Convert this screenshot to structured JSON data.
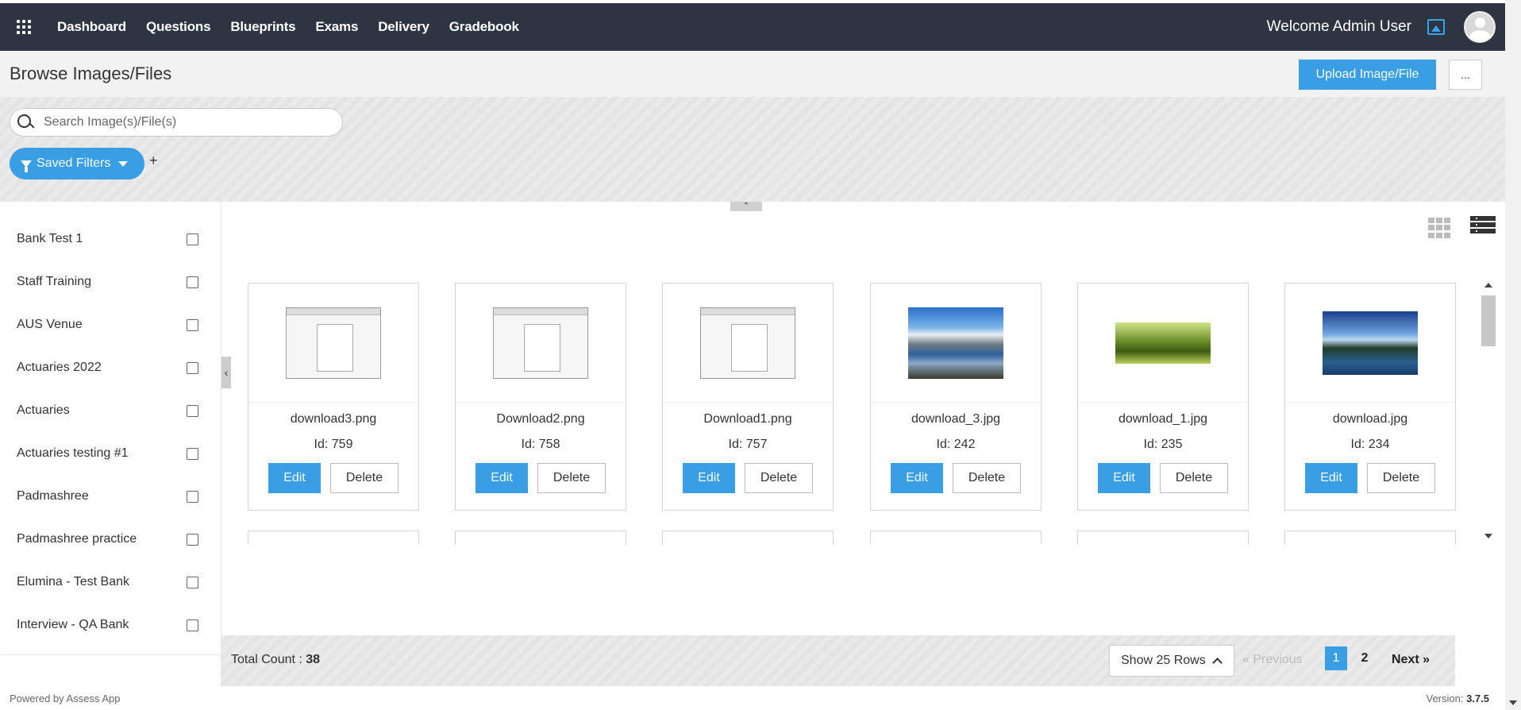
{
  "nav": {
    "items": [
      "Dashboard",
      "Questions",
      "Blueprints",
      "Exams",
      "Delivery",
      "Gradebook"
    ],
    "welcome": "Welcome Admin User",
    "icons": [
      "apps-grid-icon",
      "image-icon",
      "avatar-icon"
    ]
  },
  "page": {
    "title": "Browse Images/Files",
    "upload_label": "Upload Image/File",
    "more_label": "..."
  },
  "search": {
    "placeholder": "Search Image(s)/File(s)"
  },
  "filters": {
    "saved_label": "Saved Filters",
    "add_label": "+"
  },
  "banks": [
    "Bank Test 1",
    "Staff Training",
    "AUS Venue",
    "Actuaries 2022",
    "Actuaries",
    "Actuaries testing #1",
    "Padmashree",
    "Padmashree practice",
    "Elumina - Test Bank",
    "Interview - QA Bank"
  ],
  "cards": [
    {
      "name": "download3.png",
      "id": "Id: 759",
      "thumb": "screenshot"
    },
    {
      "name": "Download2.png",
      "id": "Id: 758",
      "thumb": "screenshot"
    },
    {
      "name": "Download1.png",
      "id": "Id: 757",
      "thumb": "screenshot"
    },
    {
      "name": "download_3.jpg",
      "id": "Id: 242",
      "thumb": "mountain"
    },
    {
      "name": "download_1.jpg",
      "id": "Id: 235",
      "thumb": "trees"
    },
    {
      "name": "download.jpg",
      "id": "Id: 234",
      "thumb": "lake"
    }
  ],
  "card_actions": {
    "edit": "Edit",
    "delete": "Delete"
  },
  "pagination": {
    "total_label": "Total Count : ",
    "total_value": "38",
    "rows_label": "Show 25 Rows",
    "prev_label": "« Previous",
    "page1": "1",
    "page2": "2",
    "next_label": "Next »"
  },
  "footer": {
    "powered": "Powered by Assess App",
    "version_label": "Version: ",
    "version_value": "3.7.5"
  },
  "colors": {
    "topbar": "#2d3542",
    "accent": "#3a9ee4"
  }
}
